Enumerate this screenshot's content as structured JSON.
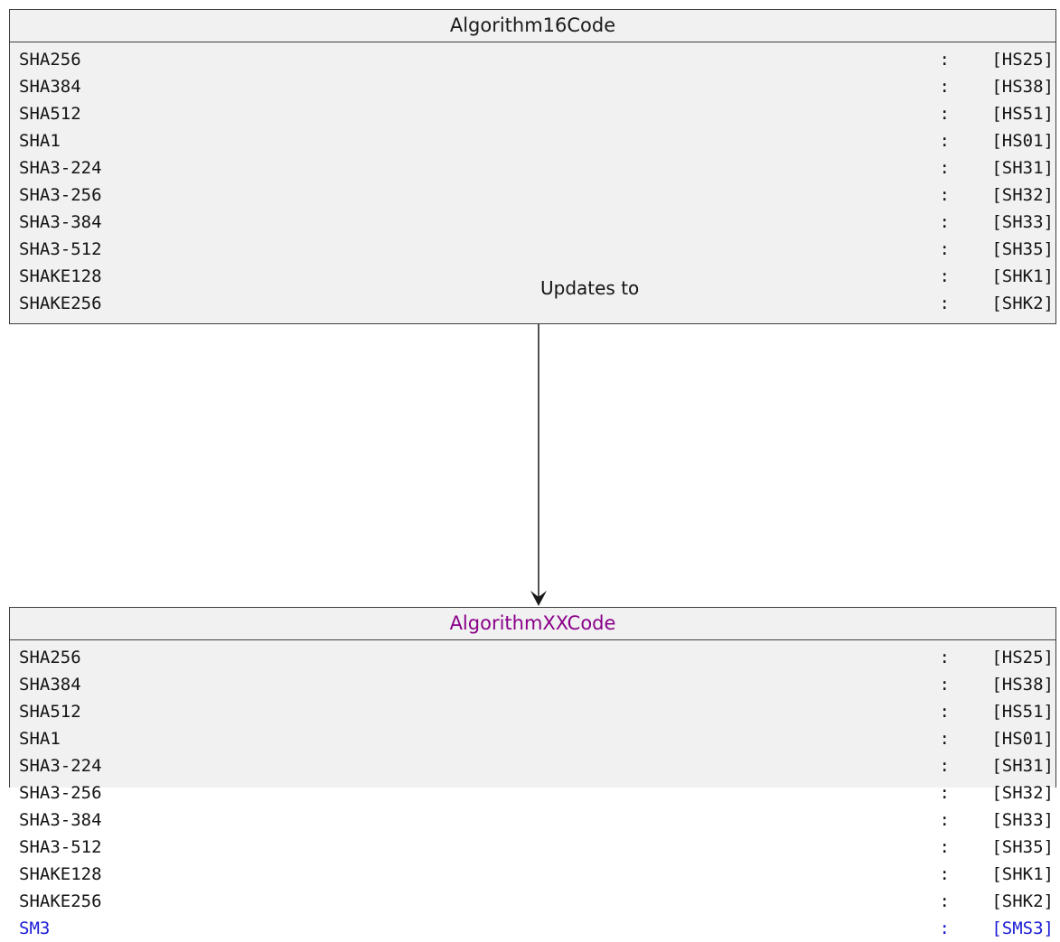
{
  "source": {
    "title": "Algorithm16Code",
    "entries": [
      {
        "name": "SHA256",
        "sep": ":",
        "code": "[HS25]"
      },
      {
        "name": "SHA384",
        "sep": ":",
        "code": "[HS38]"
      },
      {
        "name": "SHA512",
        "sep": ":",
        "code": "[HS51]"
      },
      {
        "name": "SHA1",
        "sep": ":",
        "code": "[HS01]"
      },
      {
        "name": "SHA3-224",
        "sep": ":",
        "code": "[SH31]"
      },
      {
        "name": "SHA3-256",
        "sep": ":",
        "code": "[SH32]"
      },
      {
        "name": "SHA3-384",
        "sep": ":",
        "code": "[SH33]"
      },
      {
        "name": "SHA3-512",
        "sep": ":",
        "code": "[SH35]"
      },
      {
        "name": "SHAKE128",
        "sep": ":",
        "code": "[SHK1]"
      },
      {
        "name": "SHAKE256",
        "sep": ":",
        "code": "[SHK2]"
      }
    ]
  },
  "edge": {
    "label": "Updates to"
  },
  "target": {
    "title": "AlgorithmXXCode",
    "title_color": "#8a008a",
    "added_color": "#1b1bd6",
    "entries": [
      {
        "name": "SHA256",
        "sep": ":",
        "code": "[HS25]"
      },
      {
        "name": "SHA384",
        "sep": ":",
        "code": "[HS38]"
      },
      {
        "name": "SHA512",
        "sep": ":",
        "code": "[HS51]"
      },
      {
        "name": "SHA1",
        "sep": ":",
        "code": "[HS01]"
      },
      {
        "name": "SHA3-224",
        "sep": ":",
        "code": "[SH31]"
      },
      {
        "name": "SHA3-256",
        "sep": ":",
        "code": "[SH32]"
      },
      {
        "name": "SHA3-384",
        "sep": ":",
        "code": "[SH33]"
      },
      {
        "name": "SHA3-512",
        "sep": ":",
        "code": "[SH35]"
      },
      {
        "name": "SHAKE128",
        "sep": ":",
        "code": "[SHK1]"
      },
      {
        "name": "SHAKE256",
        "sep": ":",
        "code": "[SHK2]"
      },
      {
        "name": "SM3",
        "sep": ":",
        "code": "[SMS3]",
        "added": true
      }
    ]
  }
}
